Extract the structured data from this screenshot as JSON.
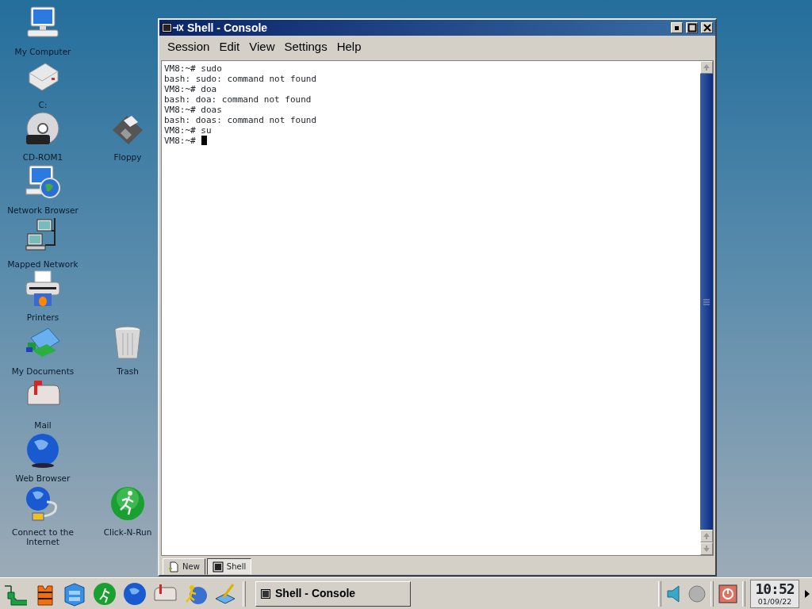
{
  "desktop_icons": [
    {
      "label": "My Computer",
      "kind": "computer"
    },
    {
      "label": "C:",
      "kind": "drive"
    },
    {
      "label": "CD-ROM1",
      "kind": "cd"
    },
    {
      "label": "Floppy",
      "kind": "floppy"
    },
    {
      "label": "Network Browser",
      "kind": "network"
    },
    {
      "label": "Mapped Network",
      "kind": "mapped"
    },
    {
      "label": "Printers",
      "kind": "printer"
    },
    {
      "label": "My Documents",
      "kind": "documents"
    },
    {
      "label": "Trash",
      "kind": "trash"
    },
    {
      "label": "Mail",
      "kind": "mail"
    },
    {
      "label": "Web Browser",
      "kind": "globe"
    },
    {
      "label": "Connect to the Internet",
      "kind": "connect"
    },
    {
      "label": "Click-N-Run",
      "kind": "runner"
    }
  ],
  "window": {
    "title": "Shell - Console",
    "menu": [
      "Session",
      "Edit",
      "View",
      "Settings",
      "Help"
    ],
    "terminal_lines": [
      "VM8:~# sudo",
      "bash: sudo: command not found",
      "VM8:~# doa",
      "bash: doa: command not found",
      "VM8:~# doas",
      "bash: doas: command not found",
      "VM8:~# su",
      "VM8:~#"
    ],
    "cursor_visible": true,
    "tabs": [
      {
        "label": "New",
        "selected": false
      },
      {
        "label": "Shell",
        "selected": true
      }
    ]
  },
  "taskbar": {
    "tasks": [
      {
        "label": "Shell - Console",
        "selected": false
      }
    ],
    "clock": "10:52",
    "date": "01/09/22"
  }
}
